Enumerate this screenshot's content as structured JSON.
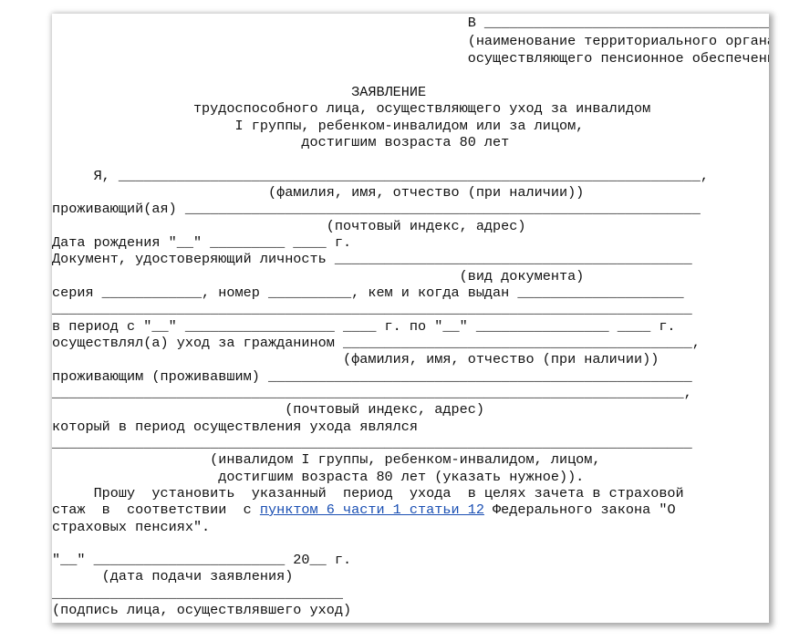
{
  "document": {
    "lines": [
      {
        "text": "                                                  В _______________________________________"
      },
      {
        "text": "                                                  (наименование территориального органа,"
      },
      {
        "text": "                                                  осуществляющего пенсионное обеспечение)"
      },
      {
        "text": ""
      },
      {
        "text": "                                    ЗАЯВЛЕНИЕ"
      },
      {
        "text": "                 трудоспособного лица, осуществляющего уход за инвалидом"
      },
      {
        "text": "                      I группы, ребенком-инвалидом или за лицом,"
      },
      {
        "text": "                              достигшим возраста 80 лет"
      },
      {
        "text": ""
      },
      {
        "text": "     Я, ______________________________________________________________________,"
      },
      {
        "text": "                          (фамилия, имя, отчество (при наличии))"
      },
      {
        "text": "проживающий(ая) ______________________________________________________________"
      },
      {
        "text": "                                 (почтовый индекс, адрес)"
      },
      {
        "text": "Дата рождения \"__\" _________ ____ г."
      },
      {
        "text": "Документ, удостоверяющий личность ___________________________________________"
      },
      {
        "text": "                                                 (вид документа)"
      },
      {
        "text": "серия ____________, номер __________, кем и когда выдан ____________________"
      },
      {
        "text": "_____________________________________________________________________________"
      },
      {
        "text": "в период с \"__\" __________________ ____ г. по \"__\" ________________ ____ г."
      },
      {
        "text": "осуществлял(а) уход за гражданином __________________________________________,"
      },
      {
        "text": "                                   (фамилия, имя, отчество (при наличии))"
      },
      {
        "text": "проживающим (проживавшим) ___________________________________________________"
      },
      {
        "text": "____________________________________________________________________________,"
      },
      {
        "text": "                            (почтовый индекс, адрес)"
      },
      {
        "text": "который в период осуществления ухода являлся"
      },
      {
        "text": "_____________________________________________________________________________"
      },
      {
        "text": "                   (инвалидом I группы, ребенком-инвалидом, лицом,"
      },
      {
        "text": "                    достигшим возраста 80 лет (указать нужное))."
      },
      {
        "text": "     Прошу  установить  указанный  период  ухода  в целях зачета в страховой"
      },
      {
        "pre": "стаж  в  соответствии  с ",
        "link": "пунктом 6 части 1 статьи 12",
        "post": " Федерального закона \"О"
      },
      {
        "text": "страховых пенсиях\"."
      },
      {
        "text": ""
      },
      {
        "text": "\"__\" _______________________ 20__ г."
      },
      {
        "text": "      (дата подачи заявления)"
      },
      {
        "text": ""
      },
      {
        "text": "___________________________________"
      },
      {
        "text": "(подпись лица, осуществлявшего уход)"
      }
    ]
  }
}
